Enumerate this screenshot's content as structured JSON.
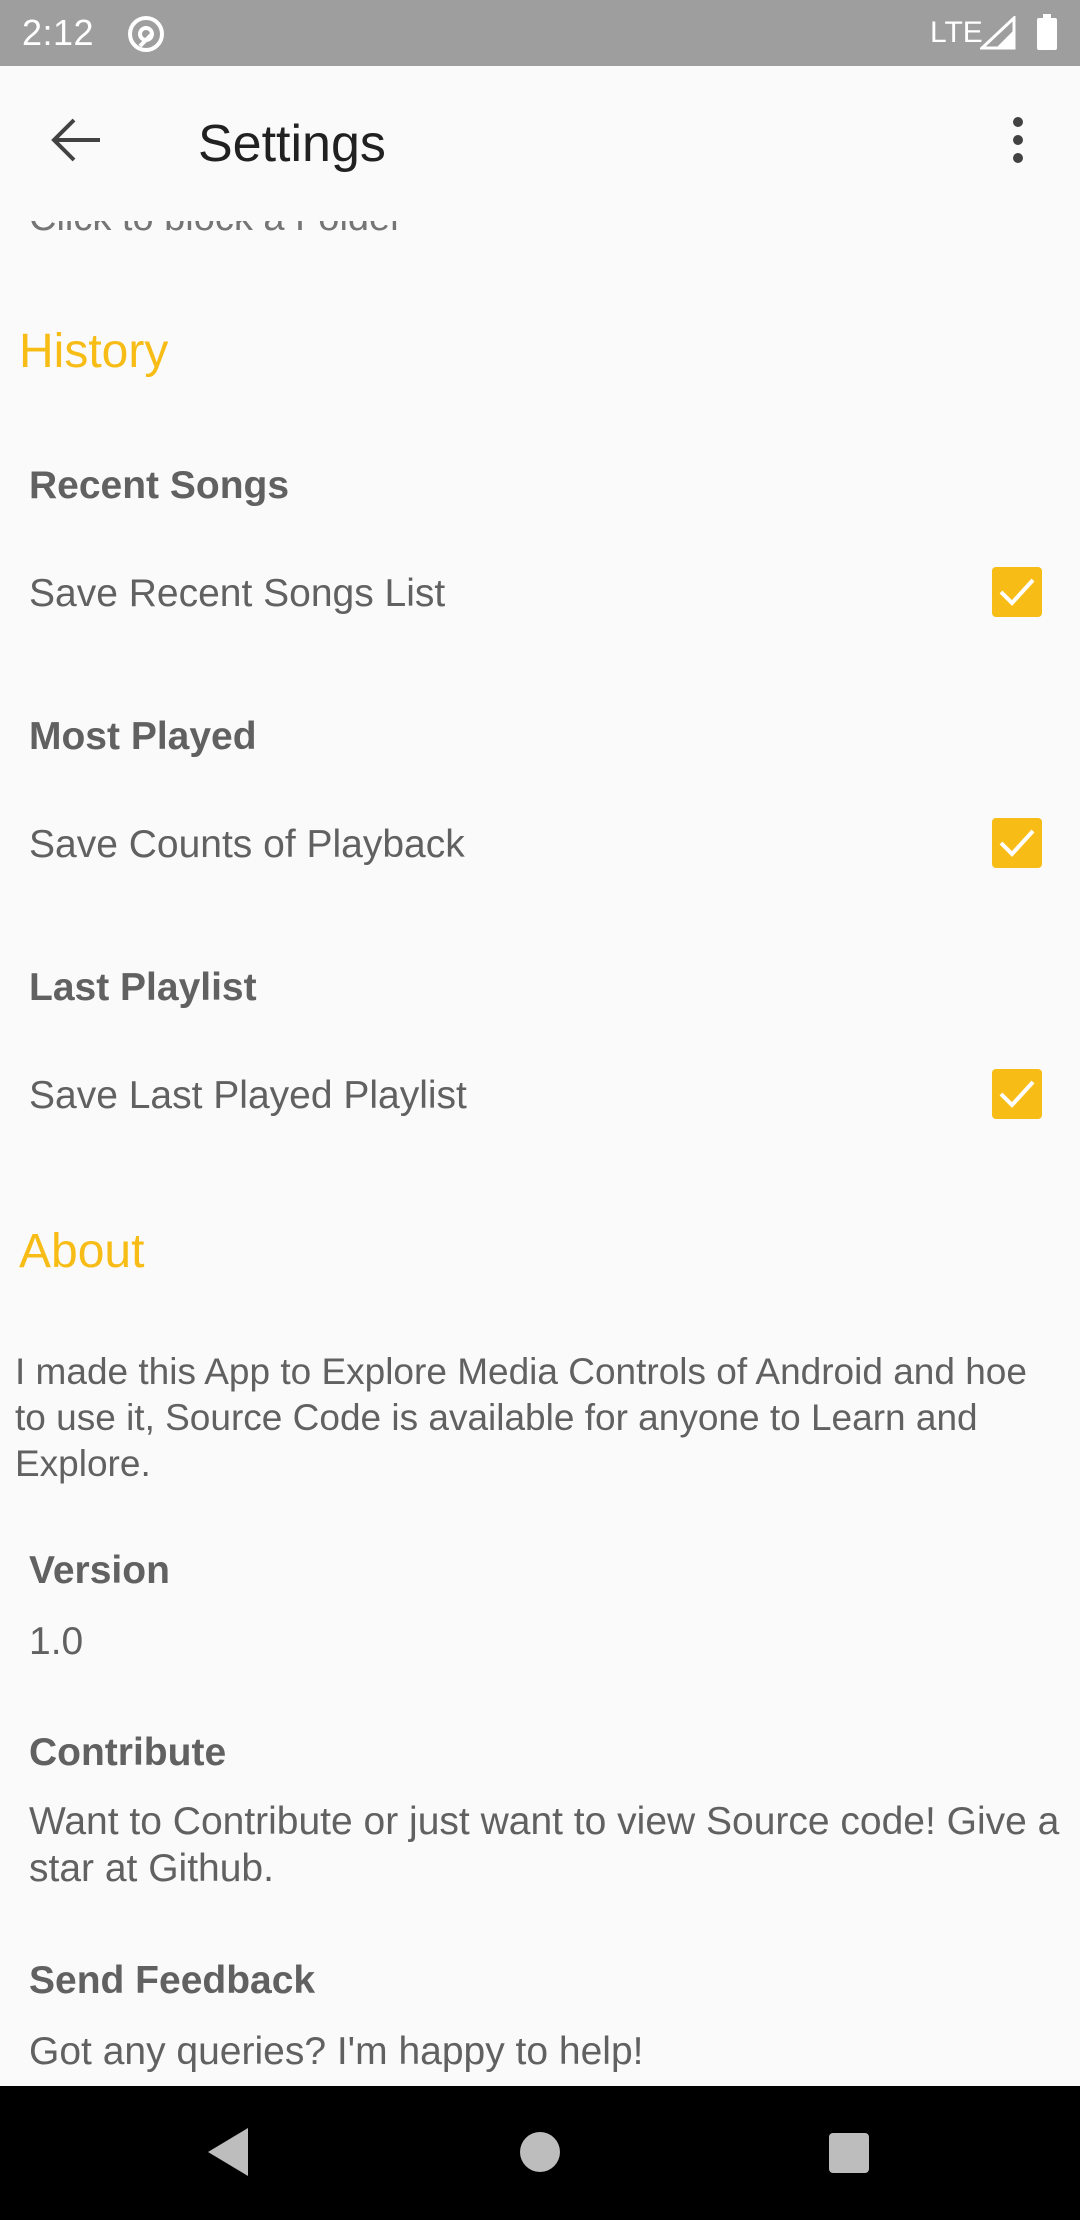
{
  "status_bar": {
    "time": "2:12",
    "network": "LTE"
  },
  "toolbar": {
    "title": "Settings"
  },
  "cut_off_summary": "Click to block a Folder",
  "history": {
    "header": "History",
    "recent_songs": {
      "title": "Recent Songs",
      "summary": "Save Recent Songs List",
      "checked": true
    },
    "most_played": {
      "title": "Most Played",
      "summary": "Save Counts of Playback",
      "checked": true
    },
    "last_playlist": {
      "title": "Last Playlist",
      "summary": "Save Last Played Playlist",
      "checked": true
    }
  },
  "about": {
    "header": "About",
    "description": "I made this App to Explore Media Controls of Android and hoe to use it, Source Code is available for anyone to Learn and Explore.",
    "version": {
      "title": "Version",
      "summary": "1.0"
    },
    "contribute": {
      "title": "Contribute",
      "summary": "Want to Contribute or just want to view Source code! Give a star at Github."
    },
    "feedback": {
      "title": "Send Feedback",
      "summary": "Got any queries? I'm happy to help!"
    }
  },
  "colors": {
    "accent": "#f7bd16",
    "status_bar": "#9e9e9e",
    "background": "#fafafa"
  }
}
